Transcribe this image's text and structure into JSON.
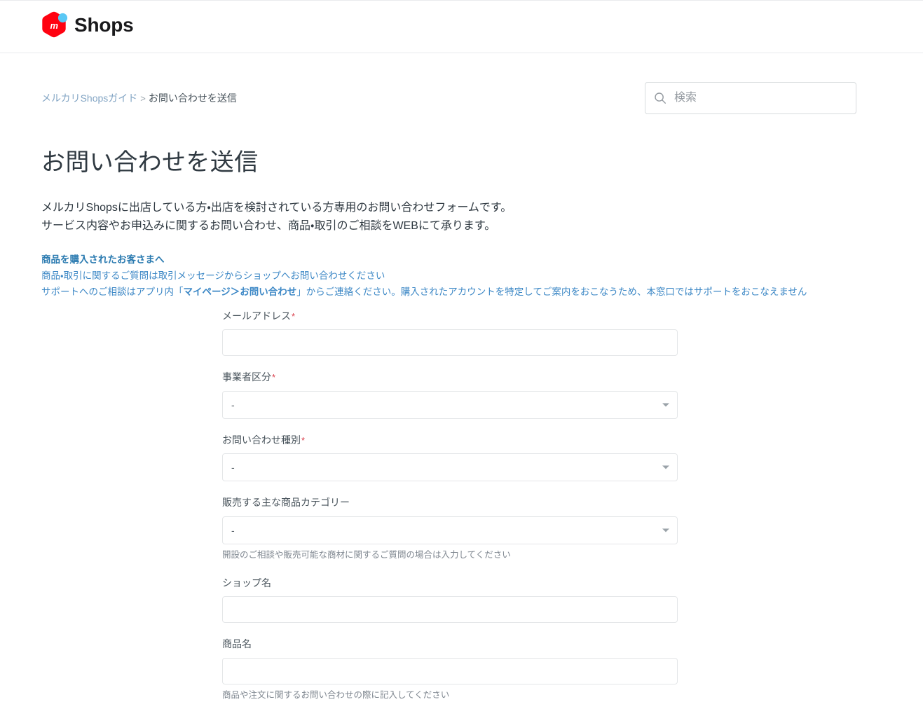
{
  "header": {
    "brand_name": "Shops",
    "logo_icon": "mercari-hexagon-logo"
  },
  "breadcrumb": {
    "root_label": "メルカリShopsガイド",
    "separator": ">",
    "current_label": "お問い合わせを送信"
  },
  "search": {
    "placeholder": "検索",
    "value": "",
    "icon": "search-icon"
  },
  "article": {
    "title": "お問い合わせを送信",
    "intro_line1": "メルカリShopsに出店している方・出店を検討されている方専用のお問い合わせフォームです。",
    "intro_line2": "サービス内容やお申込みに関するお問い合わせ、商品・取引のご相談をWEBにて承ります。",
    "notice": {
      "heading": "商品を購入されたお客さまへ",
      "line1": "商品・取引に関するご質問は取引メッセージからショップへお問い合わせください",
      "line2_prefix": "サポートへのご相談はアプリ内「",
      "line2_bold": "マイページ＞お問い合わせ",
      "line2_suffix": "」からご連絡ください。購入されたアカウントを特定してご案内をおこなうため、本窓口ではサポートをおこなえません"
    }
  },
  "form": {
    "fields": [
      {
        "name": "email",
        "label": "メールアドレス",
        "required": true,
        "required_mark": "*",
        "type": "text",
        "value": "",
        "help": ""
      },
      {
        "name": "business-type",
        "label": "事業者区分",
        "required": true,
        "required_mark": "*",
        "type": "select",
        "value": "-",
        "help": ""
      },
      {
        "name": "inquiry-type",
        "label": "お問い合わせ種別",
        "required": true,
        "required_mark": "*",
        "type": "select",
        "value": "-",
        "help": ""
      },
      {
        "name": "product-category",
        "label": "販売する主な商品カテゴリー",
        "required": false,
        "required_mark": "",
        "type": "select",
        "value": "-",
        "help": "開設のご相談や販売可能な商材に関するご質問の場合は入力してください"
      },
      {
        "name": "shop-name",
        "label": "ショップ名",
        "required": false,
        "required_mark": "",
        "type": "text",
        "value": "",
        "help": ""
      },
      {
        "name": "product-name",
        "label": "商品名",
        "required": false,
        "required_mark": "",
        "type": "text",
        "value": "",
        "help": "商品や注文に関するお問い合わせの際に記入してください"
      }
    ]
  },
  "colors": {
    "brand_red": "#ff0211",
    "brand_blue": "#5ac8f5",
    "link_blue": "#83a5c4",
    "notice_blue": "#3d88c6",
    "required_red": "#d93f4c",
    "text_primary": "#2f3941",
    "border": "#e4e6e8"
  }
}
